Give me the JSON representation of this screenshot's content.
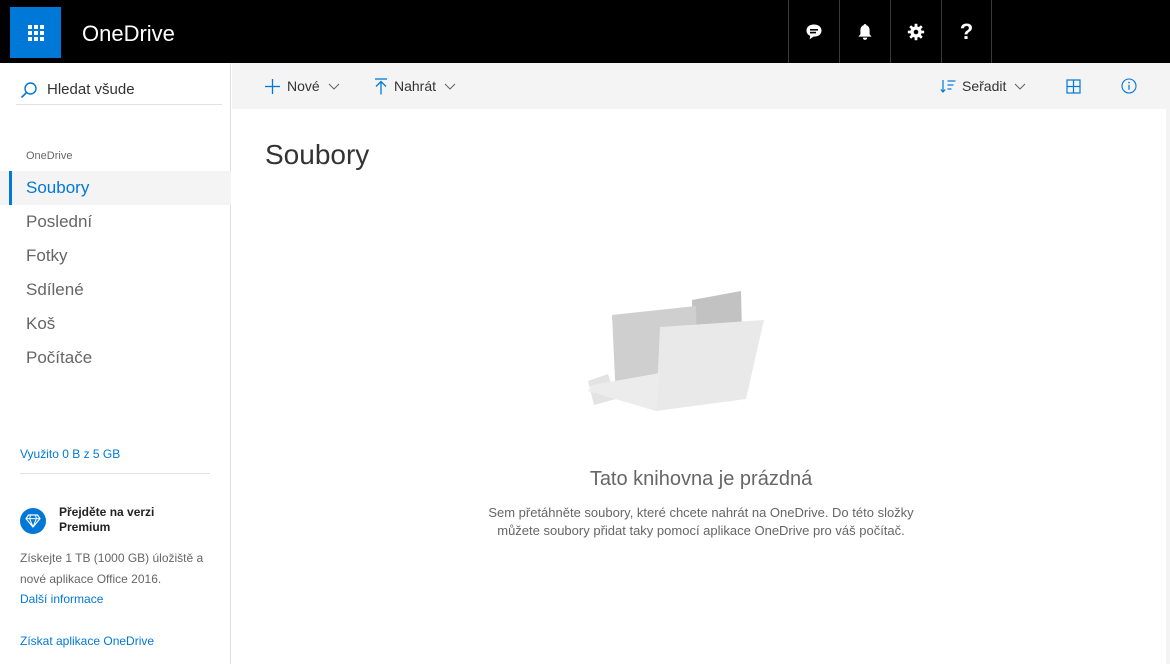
{
  "topbar": {
    "brand": "OneDrive",
    "icons": [
      "waffle-icon",
      "feedback-icon",
      "bell-icon",
      "gear-icon",
      "help-icon"
    ],
    "help_glyph": "?"
  },
  "sidebar": {
    "search_label": "Hledat všude",
    "heading": "OneDrive",
    "items": [
      {
        "label": "Soubory",
        "active": true
      },
      {
        "label": "Poslední",
        "active": false
      },
      {
        "label": "Fotky",
        "active": false
      },
      {
        "label": "Sdílené",
        "active": false
      },
      {
        "label": "Koš",
        "active": false
      },
      {
        "label": "Počítače",
        "active": false
      }
    ],
    "storage": "Využito 0 B z 5 GB",
    "premium": {
      "title_line1": "Přejděte na verzi",
      "title_line2": "Premium",
      "desc": "Získejte 1 TB (1000 GB) úložiště a nové aplikace Office 2016.",
      "link": "Další informace"
    },
    "get_apps": "Získat aplikace OneDrive"
  },
  "commandbar": {
    "new_label": "Nové",
    "upload_label": "Nahrát",
    "sort_label": "Seřadit"
  },
  "main": {
    "title": "Soubory",
    "empty_title": "Tato knihovna je prázdná",
    "empty_desc": "Sem přetáhněte soubory, které chcete nahrát na OneDrive. Do této složky můžete soubory přidat taky pomocí aplikace OneDrive pro váš počítač."
  },
  "colors": {
    "accent": "#0078d7",
    "topbar": "#000000",
    "commandbar": "#f4f4f4"
  }
}
